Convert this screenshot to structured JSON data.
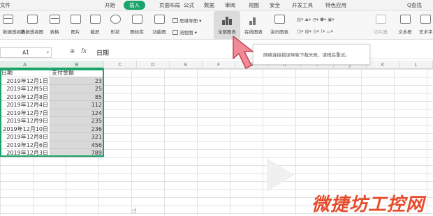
{
  "menu": {
    "items": [
      "文件",
      "开始",
      "插入",
      "页面布局",
      "公式",
      "数据",
      "审阅",
      "视图",
      "安全",
      "开发工具",
      "特色应用"
    ],
    "search": "Q查找"
  },
  "ribbon": {
    "buttons": [
      "数据透视表",
      "数据透视图",
      "表格",
      "图片",
      "截屏",
      "形状",
      "图标库",
      "功能图",
      "全部图表",
      "在线图表",
      "演示图表",
      "切片器",
      "文本框",
      "艺术字"
    ],
    "mindmap": "思维导图",
    "flowchart": "流程图"
  },
  "formula_bar": {
    "name_box": "A1",
    "fx_label": "fx",
    "content": "日期"
  },
  "sheet": {
    "columns": [
      "A",
      "B",
      "C",
      "D",
      "E",
      "F",
      "G",
      "H",
      "I",
      "J",
      "K",
      "L",
      "M"
    ],
    "header_a": "日期",
    "header_b": "支付金额",
    "rows": [
      {
        "date": "2019年12月1日",
        "amount": "23"
      },
      {
        "date": "2019年12月5日",
        "amount": "25"
      },
      {
        "date": "2019年12月8日",
        "amount": "85"
      },
      {
        "date": "2019年12月4日",
        "amount": "112"
      },
      {
        "date": "2019年12月7日",
        "amount": "124"
      },
      {
        "date": "2019年12月9日",
        "amount": "235"
      },
      {
        "date": "2019年12月10日",
        "amount": "236"
      },
      {
        "date": "2019年12月8日",
        "amount": "321"
      },
      {
        "date": "2019年12月6日",
        "amount": "456"
      },
      {
        "date": "2019年12月3日",
        "amount": "789"
      }
    ]
  },
  "tooltip": "网络连接错误导致下载失败，请稍后重试。",
  "watermark": "微捷坊工控网",
  "colors": {
    "accent": "#1aa36b",
    "pointer": "#f08a96",
    "brand": "#e64b2b"
  }
}
